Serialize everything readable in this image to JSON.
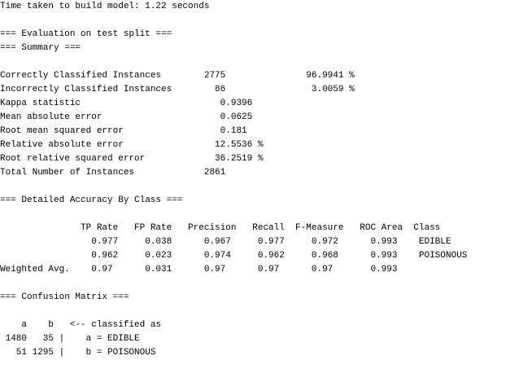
{
  "output": {
    "lines": [
      "Time taken to build model: 1.22 seconds",
      "",
      "=== Evaluation on test split ===",
      "=== Summary ===",
      "",
      "Correctly Classified Instances        2775               96.9941 %",
      "Incorrectly Classified Instances        86                3.0059 %",
      "Kappa statistic                          0.9396",
      "Mean absolute error                      0.0625",
      "Root mean squared error                  0.181 ",
      "Relative absolute error                 12.5536 %",
      "Root relative squared error             36.2519 %",
      "Total Number of Instances             2861     ",
      "",
      "=== Detailed Accuracy By Class ===",
      "",
      "               TP Rate   FP Rate   Precision   Recall  F-Measure   ROC Area  Class",
      "                 0.977     0.038      0.967     0.977     0.972      0.993    EDIBLE",
      "                 0.962     0.023      0.974     0.962     0.968      0.993    POISONOUS",
      "Weighted Avg.    0.97      0.031      0.97      0.97      0.97       0.993",
      "",
      "=== Confusion Matrix ===",
      "",
      "    a    b   <-- classified as",
      " 1480   35 |    a = EDIBLE",
      "   51 1295 |    b = POISONOUS"
    ]
  }
}
